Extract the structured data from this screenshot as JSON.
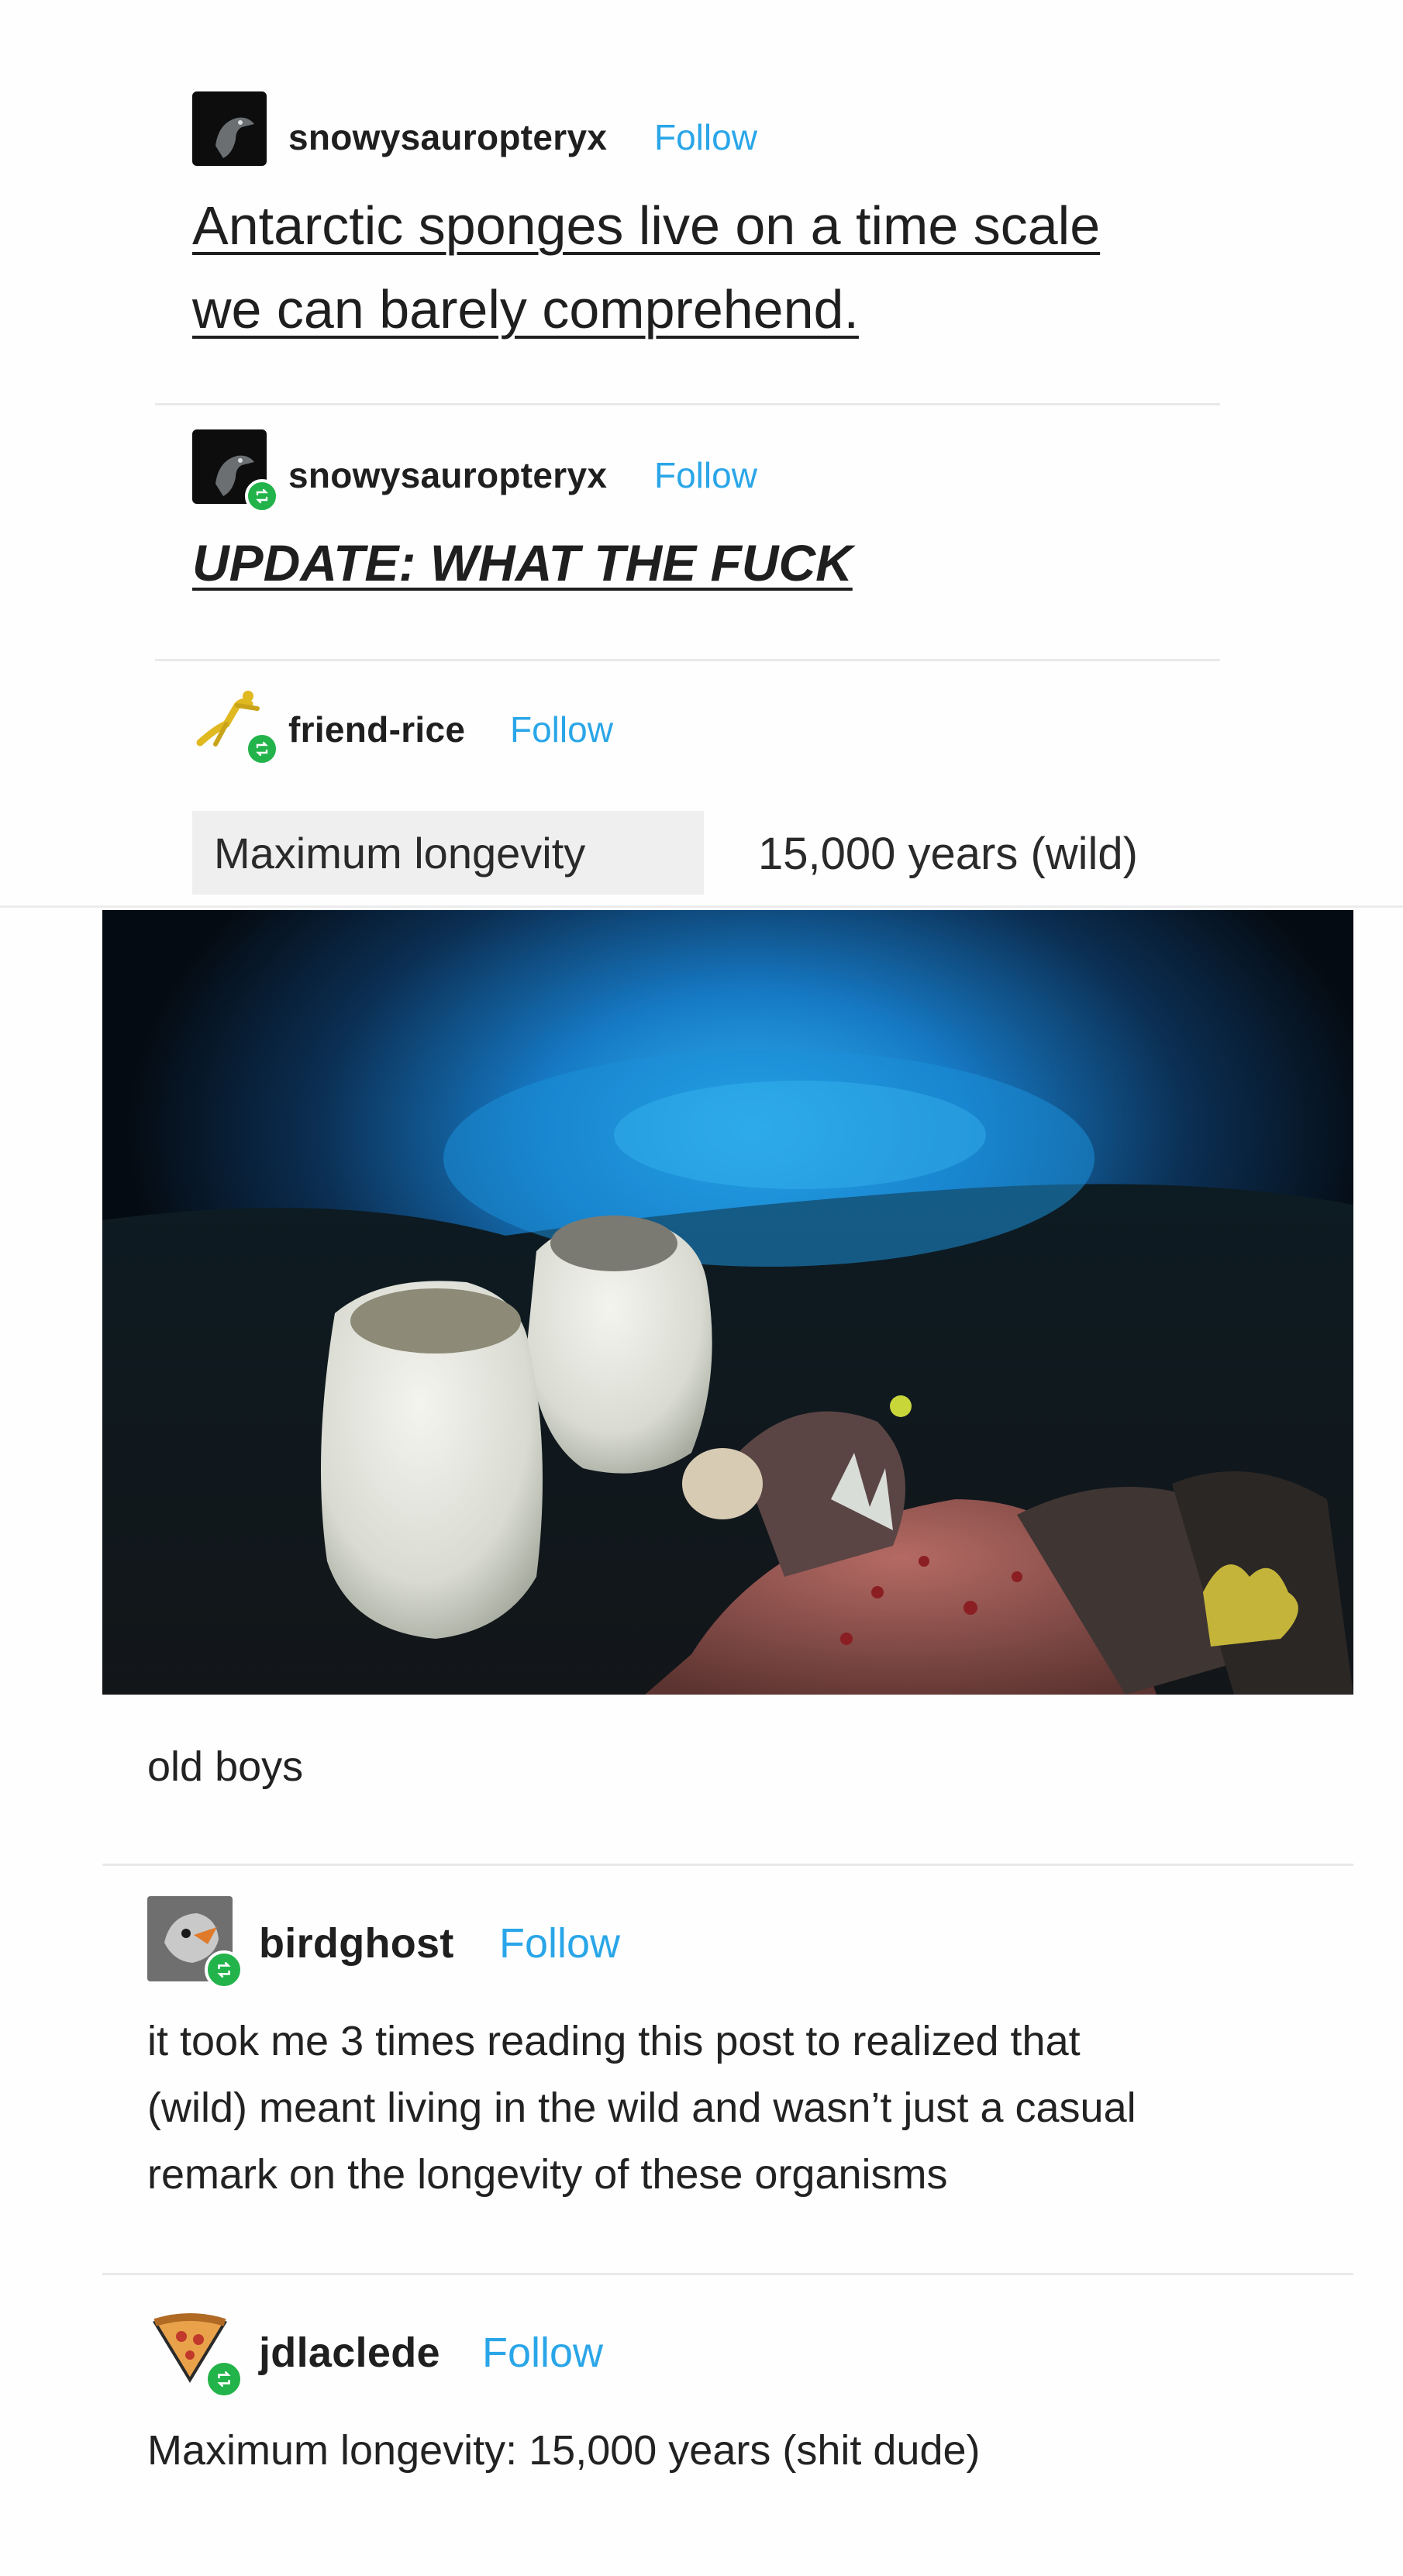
{
  "posts": [
    {
      "username": "snowysauropteryx",
      "follow": "Follow",
      "title_line1": "Antarctic sponges live on a time scale",
      "title_line2": "we can barely comprehend."
    },
    {
      "username": "snowysauropteryx",
      "follow": "Follow",
      "text": "UPDATE: WHAT THE FUCK"
    },
    {
      "username": "friend-rice",
      "follow": "Follow",
      "info_label": "Maximum longevity",
      "info_value": "15,000 years (wild)",
      "image_caption": "old boys"
    },
    {
      "username": "birdghost",
      "follow": "Follow",
      "text_line1": "it took me 3 times reading this post to realized that",
      "text_line2": "(wild) meant living in the wild and wasn’t just a casual",
      "text_line3": "remark on the longevity of these organisms"
    },
    {
      "username": "jdlaclede",
      "follow": "Follow",
      "text": "Maximum longevity: 15,000 years (shit dude)"
    }
  ],
  "icons": {
    "reblog": "reblog-icon",
    "avatar_1": "bird-avatar-icon",
    "avatar_3": "running-figure-avatar-icon",
    "avatar_4": "ghost-bird-avatar-icon",
    "avatar_5": "pizza-slice-avatar-icon"
  },
  "colors": {
    "follow": "#2aa6e8",
    "reblog_badge": "#22b34a",
    "divider": "#e9e9e9"
  }
}
